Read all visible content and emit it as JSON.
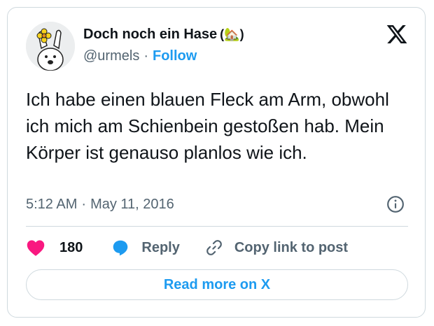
{
  "tweet": {
    "author_name": "Doch noch ein Hase",
    "author_emoji": "(🏡)",
    "handle": "@urmels",
    "separator": "·",
    "follow_label": "Follow",
    "text": "Ich habe einen blauen Fleck am Arm, obwohl ich mich am Schienbein gestoßen hab. Mein Körper ist genauso planlos wie ich.",
    "time": "5:12 AM",
    "date": "May 11, 2016",
    "likes_count": "180",
    "reply_label": "Reply",
    "copy_link_label": "Copy link to post",
    "read_more_label": "Read more on X"
  },
  "icons": {
    "logo": "x-logo-icon",
    "info": "info-icon",
    "like": "heart-icon",
    "reply": "speech-bubble-icon",
    "copy": "link-icon"
  },
  "colors": {
    "accent": "#1d9bf0",
    "heart": "#f91880",
    "text": "#0f1419",
    "secondary": "#536471",
    "border": "#cfd9de"
  }
}
